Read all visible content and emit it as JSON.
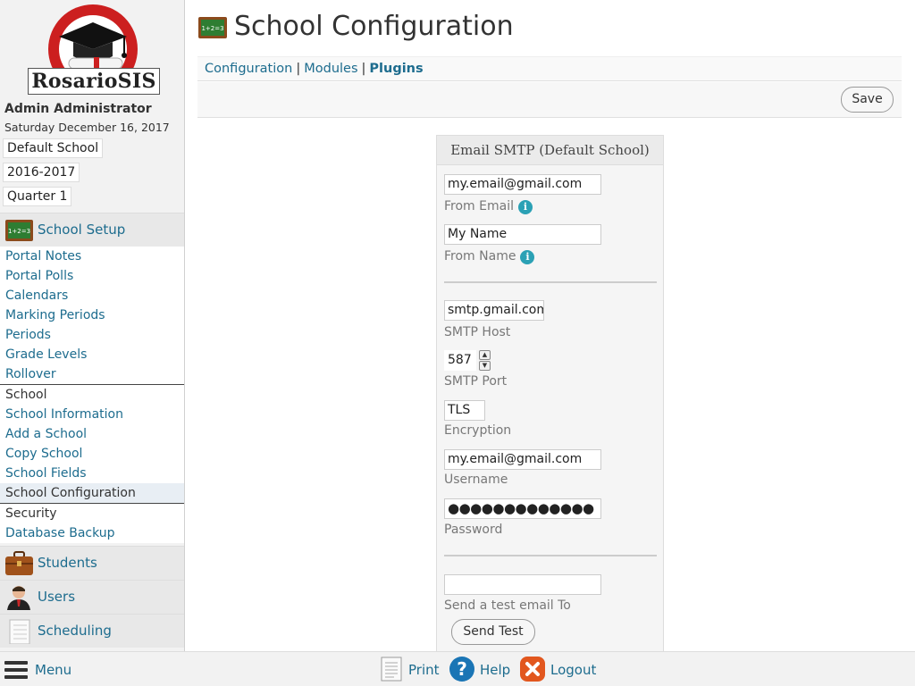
{
  "app": {
    "name": "RosarioSIS",
    "user": "Admin Administrator",
    "date": "Saturday December 16, 2017",
    "school_select": "Default School",
    "year_select": "2016-2017",
    "period_select": "Quarter 1"
  },
  "sidebar": {
    "school_setup": "School Setup",
    "group1": [
      "Portal Notes",
      "Portal Polls",
      "Calendars",
      "Marking Periods",
      "Periods",
      "Grade Levels",
      "Rollover"
    ],
    "school_title": "School",
    "group2": [
      "School Information",
      "Add a School",
      "Copy School",
      "School Fields",
      "School Configuration"
    ],
    "security_title": "Security",
    "group3": [
      "Database Backup"
    ],
    "students": "Students",
    "users": "Users",
    "scheduling": "Scheduling"
  },
  "page": {
    "title": "School Configuration",
    "tabs": [
      "Configuration",
      "Modules",
      "Plugins"
    ],
    "tab_sep": "|",
    "save": "Save"
  },
  "form": {
    "heading": "Email SMTP (Default School)",
    "from_email": {
      "value": "my.email@gmail.com",
      "label": "From Email"
    },
    "from_name": {
      "value": "My Name",
      "label": "From Name"
    },
    "smtp_host": {
      "value": "smtp.gmail.com",
      "label": "SMTP Host"
    },
    "smtp_port": {
      "value": "587",
      "label": "SMTP Port"
    },
    "encryption": {
      "value": "TLS",
      "label": "Encryption"
    },
    "username": {
      "value": "my.email@gmail.com",
      "label": "Username"
    },
    "password": {
      "value": "●●●●●●●●●●●●●",
      "label": "Password"
    },
    "test_email": {
      "value": "",
      "label": "Send a test email To"
    },
    "send_test": "Send Test",
    "info_glyph": "i",
    "spin_up": "▲",
    "spin_down": "▼"
  },
  "bottom": {
    "menu": "Menu",
    "print": "Print",
    "help": "Help",
    "logout": "Logout"
  },
  "colors": {
    "link": "#1d6c8e",
    "info": "#2ba1b5",
    "logo_red": "#cc1f1f",
    "logout_orange": "#e2571e",
    "help_blue": "#1a75b5"
  },
  "icons": {
    "logo": "graduation-cap-logo",
    "school_setup": "chalkboard-icon",
    "students": "briefcase-icon",
    "users": "user-icon",
    "scheduling": "notepad-icon",
    "print": "document-icon",
    "help": "question-icon",
    "logout": "x-icon"
  }
}
